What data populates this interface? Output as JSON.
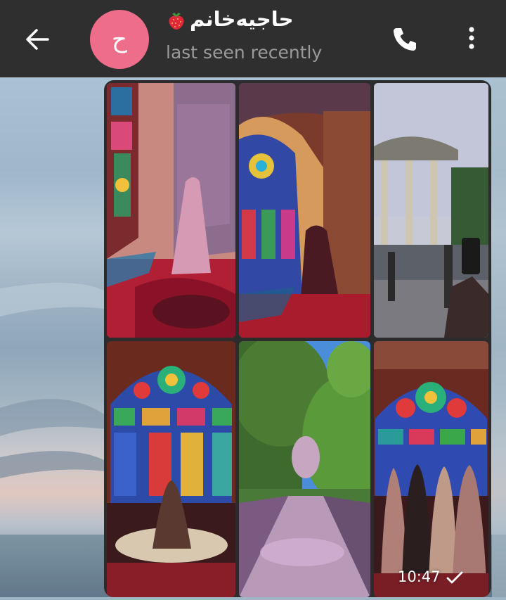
{
  "header": {
    "back_icon": "arrow-left-icon",
    "avatar_letter": "ح",
    "avatar_color": "#ee6d8a",
    "contact_name": "حاجیه‌خانم",
    "name_emoji_icon": "strawberry-icon",
    "status": "last seen recently",
    "call_icon": "phone-icon",
    "menu_icon": "more-vertical-icon"
  },
  "message": {
    "type": "photo-album",
    "photo_count": 6,
    "time": "10:47",
    "status_icon": "check-icon"
  },
  "colors": {
    "header_bg": "#2f2f2f",
    "album_border": "#2c2c2c",
    "status_gray": "#9a9a9a"
  }
}
